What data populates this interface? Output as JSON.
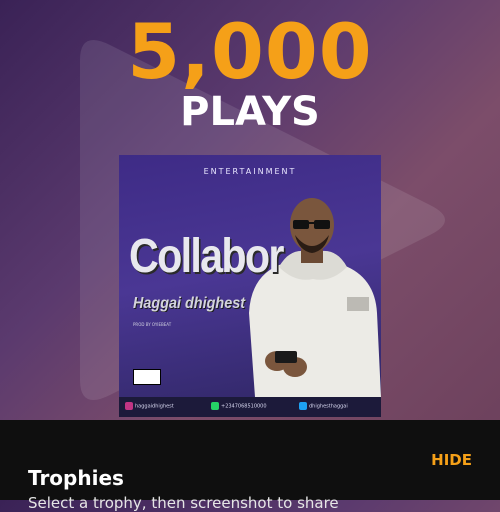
{
  "header": {
    "count": "5,000",
    "unit": "PLAYS"
  },
  "cover": {
    "label": "ENTERTAINMENT",
    "title": "Collabor",
    "artist": "Haggai dhighest",
    "producer": "PROD BY OYIEBEAT",
    "advisory": "PARENTAL ADVISORY EXPLICIT CONTENT",
    "social": {
      "instagram": "haggaidhighest",
      "whatsapp": "+2347068510000",
      "twitter": "dhighesthaggai"
    }
  },
  "sheet": {
    "hide_label": "HIDE",
    "title": "Trophies",
    "subtitle": "Select a trophy, then screenshot to share"
  },
  "colors": {
    "accent": "#f5a018",
    "sheet_bg": "#0f0f0f"
  }
}
